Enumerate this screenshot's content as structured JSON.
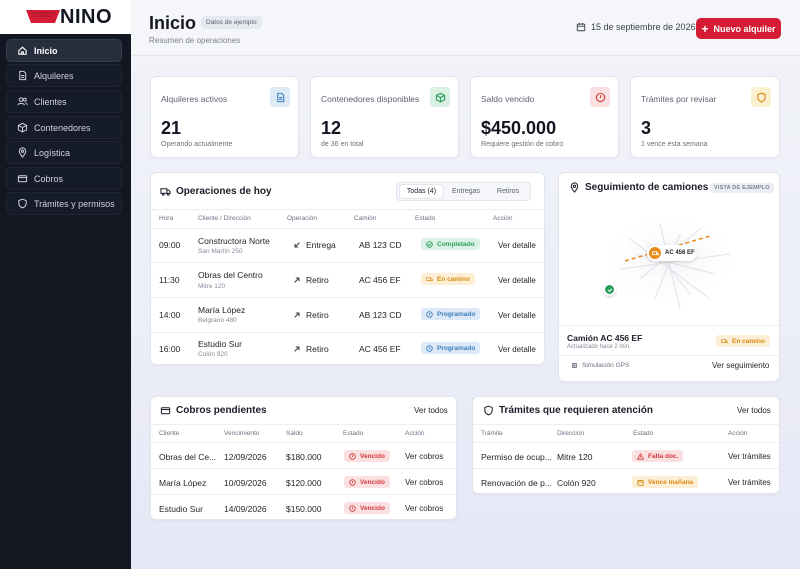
{
  "app": {
    "brand": "NINO"
  },
  "sidebar": {
    "items": [
      {
        "label": "Inicio",
        "icon": "home-icon"
      },
      {
        "label": "Alquileres",
        "icon": "document-icon"
      },
      {
        "label": "Clientes",
        "icon": "users-icon"
      },
      {
        "label": "Contenedores",
        "icon": "box-icon"
      },
      {
        "label": "Logística",
        "icon": "map-pin-icon"
      },
      {
        "label": "Cobros",
        "icon": "credit-card-icon"
      },
      {
        "label": "Trámites y permisos",
        "icon": "shield-icon"
      }
    ]
  },
  "header": {
    "title": "Inicio",
    "badge": "Datos de ejemplo",
    "subtitle": "Resumen de operaciones",
    "date": "15 de septiembre de 2026",
    "new_button": "Nuevo alquiler"
  },
  "stats": [
    {
      "label": "Alquileres activos",
      "value": "21",
      "sub": "Operando actualmente",
      "icon": "document-icon"
    },
    {
      "label": "Contenedores disponibles",
      "value": "12",
      "sub": "de 36 en total",
      "icon": "box-icon"
    },
    {
      "label": "Saldo vencido",
      "value": "$450.000",
      "sub": "Requiere gestión de cobro",
      "icon": "alert-circle-icon"
    },
    {
      "label": "Trámites por revisar",
      "value": "3",
      "sub": "1 vence esta semana",
      "icon": "shield-icon"
    }
  ],
  "operations": {
    "title": "Operaciones de hoy",
    "tabs": [
      "Todas (4)",
      "Entregas",
      "Retiros"
    ],
    "columns": [
      "Hora",
      "Cliente / Dirección",
      "Operación",
      "Camión",
      "Estado",
      "Acción"
    ],
    "rows": [
      {
        "time": "09:00",
        "client": "Constructora Norte",
        "address": "San Martín 250",
        "op": "Entrega",
        "truck": "AB 123 CD",
        "status": "Completado",
        "action": "Ver detalle"
      },
      {
        "time": "11:30",
        "client": "Obras del Centro",
        "address": "Mitre 120",
        "op": "Retiro",
        "truck": "AC 456 EF",
        "status": "En camino",
        "action": "Ver detalle"
      },
      {
        "time": "14:00",
        "client": "María López",
        "address": "Belgrano 480",
        "op": "Retiro",
        "truck": "AB 123 CD",
        "status": "Programado",
        "action": "Ver detalle"
      },
      {
        "time": "16:00",
        "client": "Estudio Sur",
        "address": "Colón 920",
        "op": "Retiro",
        "truck": "AC 456 EF",
        "status": "Programado",
        "action": "Ver detalle"
      }
    ]
  },
  "tracking": {
    "title": "Seguimiento de camiones",
    "badge": "VISTA DE EJEMPLO",
    "map_label": "AC 456 EF",
    "truck": "Camión AC 456 EF",
    "updated": "Actualizado hace 2 min.",
    "status": "En camino",
    "sim": "Simulación GPS",
    "action": "Ver seguimiento"
  },
  "payments": {
    "title": "Cobros pendientes",
    "link": "Ver todos",
    "columns": [
      "Cliente",
      "Vencimiento",
      "Saldo",
      "Estado",
      "Acción"
    ],
    "rows": [
      {
        "client": "Obras del Ce...",
        "due": "12/09/2026",
        "amount": "$180.000",
        "status": "Vencido",
        "action": "Ver cobros"
      },
      {
        "client": "María López",
        "due": "10/09/2026",
        "amount": "$120.000",
        "status": "Vencido",
        "action": "Ver cobros"
      },
      {
        "client": "Estudio Sur",
        "due": "14/09/2026",
        "amount": "$150.000",
        "status": "Vencido",
        "action": "Ver cobros"
      }
    ]
  },
  "permits": {
    "title": "Trámites que requieren atención",
    "link": "Ver todos",
    "columns": [
      "Trámite",
      "Dirección",
      "Estado",
      "Acción"
    ],
    "rows": [
      {
        "name": "Permiso de ocup...",
        "address": "Mitre 120",
        "status": "Falta doc.",
        "action": "Ver trámites"
      },
      {
        "name": "Renovación de p...",
        "address": "Colón 920",
        "status": "Vence mañana",
        "action": "Ver trámites"
      }
    ]
  },
  "colors": {
    "accent": "#d41d34",
    "sidebar": "#121722",
    "success": "#2e9e5b",
    "warning": "#d98a12",
    "info": "#3d7fbf",
    "danger": "#d13a3a"
  }
}
